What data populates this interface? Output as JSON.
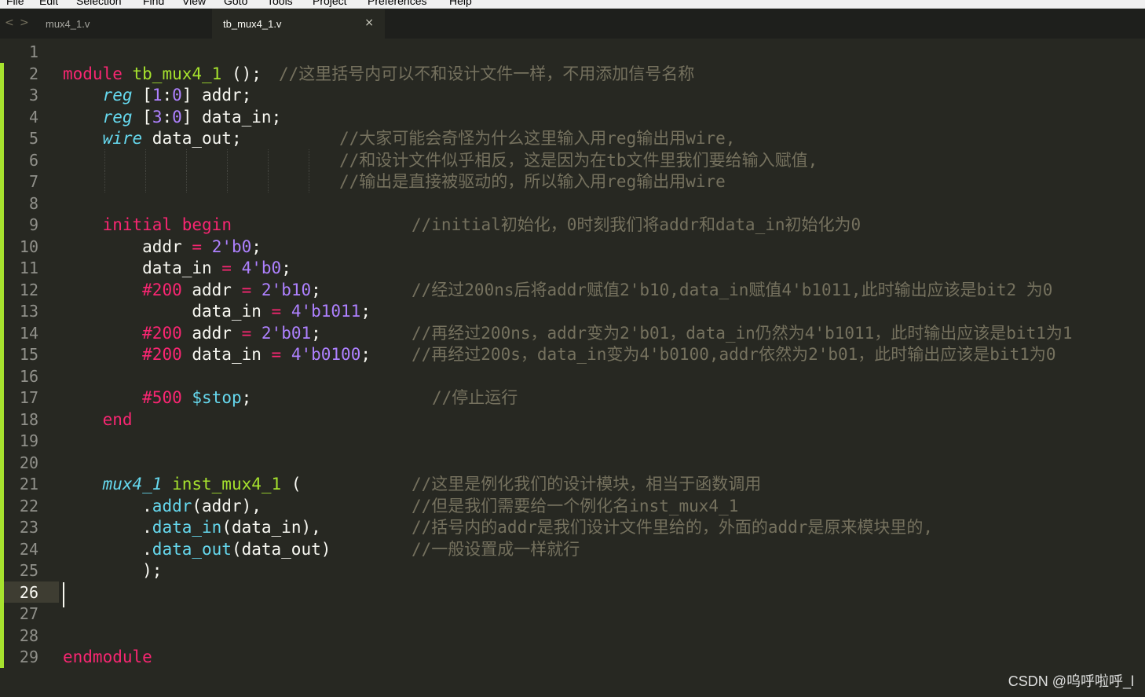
{
  "menubar": {
    "items": [
      "File",
      "Edit",
      "Selection",
      "Find",
      "View",
      "Goto",
      "Tools",
      "Project",
      "Preferences",
      "Help"
    ]
  },
  "tabs": [
    {
      "label": "mux4_1.v",
      "active": false
    },
    {
      "label": "tb_mux4_1.v",
      "active": true
    }
  ],
  "tab_close_glyph": "×",
  "nav": {
    "back": "<",
    "forward": ">"
  },
  "editor": {
    "current_line": 26,
    "lines": [
      {
        "n": "1",
        "code": "",
        "comment": ""
      },
      {
        "n": "2",
        "code": "module tb_mux4_1 ();",
        "comment": "//这里括号内可以不和设计文件一样，不用添加信号名称"
      },
      {
        "n": "3",
        "code": "    reg [1:0] addr;",
        "comment": ""
      },
      {
        "n": "4",
        "code": "    reg [3:0] data_in;",
        "comment": ""
      },
      {
        "n": "5",
        "code": "    wire data_out;",
        "comment": "//大家可能会奇怪为什么这里输入用reg输出用wire,"
      },
      {
        "n": "6",
        "code": "",
        "comment": "//和设计文件似乎相反，这是因为在tb文件里我们要给输入赋值,"
      },
      {
        "n": "7",
        "code": "",
        "comment": "//输出是直接被驱动的，所以输入用reg输出用wire"
      },
      {
        "n": "8",
        "code": "",
        "comment": ""
      },
      {
        "n": "9",
        "code": "    initial begin",
        "comment": "//initial初始化，0时刻我们将addr和data_in初始化为0"
      },
      {
        "n": "10",
        "code": "        addr = 2'b0;",
        "comment": ""
      },
      {
        "n": "11",
        "code": "        data_in = 4'b0;",
        "comment": ""
      },
      {
        "n": "12",
        "code": "        #200 addr = 2'b10;",
        "comment": "//经过200ns后将addr赋值2'b10,data_in赋值4'b1011,此时输出应该是bit2 为0"
      },
      {
        "n": "13",
        "code": "             data_in = 4'b1011;",
        "comment": ""
      },
      {
        "n": "14",
        "code": "        #200 addr = 2'b01;",
        "comment": "//再经过200ns，addr变为2'b01，data_in仍然为4'b1011，此时输出应该是bit1为1"
      },
      {
        "n": "15",
        "code": "        #200 data_in = 4'b0100;",
        "comment": "//再经过200s，data_in变为4'b0100,addr依然为2'b01，此时输出应该是bit1为0"
      },
      {
        "n": "16",
        "code": "",
        "comment": ""
      },
      {
        "n": "17",
        "code": "        #500 $stop;",
        "comment": "//停止运行"
      },
      {
        "n": "18",
        "code": "    end",
        "comment": ""
      },
      {
        "n": "19",
        "code": "",
        "comment": ""
      },
      {
        "n": "20",
        "code": "",
        "comment": ""
      },
      {
        "n": "21",
        "code": "    mux4_1 inst_mux4_1 (",
        "comment": "//这里是例化我们的设计模块，相当于函数调用"
      },
      {
        "n": "22",
        "code": "        .addr(addr),",
        "comment": "//但是我们需要给一个例化名inst_mux4_1"
      },
      {
        "n": "23",
        "code": "        .data_in(data_in),",
        "comment": "//括号内的addr是我们设计文件里给的，外面的addr是原来模块里的,"
      },
      {
        "n": "24",
        "code": "        .data_out(data_out)",
        "comment": "//一般设置成一样就行"
      },
      {
        "n": "25",
        "code": "        );",
        "comment": ""
      },
      {
        "n": "26",
        "code": "",
        "comment": ""
      },
      {
        "n": "27",
        "code": "",
        "comment": ""
      },
      {
        "n": "28",
        "code": "",
        "comment": ""
      },
      {
        "n": "29",
        "code": "endmodule",
        "comment": ""
      }
    ]
  },
  "watermark": "CSDN @呜呼啦呼_l",
  "colors": {
    "background": "#272822",
    "keyword": "#f92672",
    "function": "#a6e22e",
    "type": "#66d9ef",
    "number": "#ae81ff",
    "comment": "#75715e",
    "text": "#f8f8f2",
    "modified_bar": "#a6e22e"
  }
}
